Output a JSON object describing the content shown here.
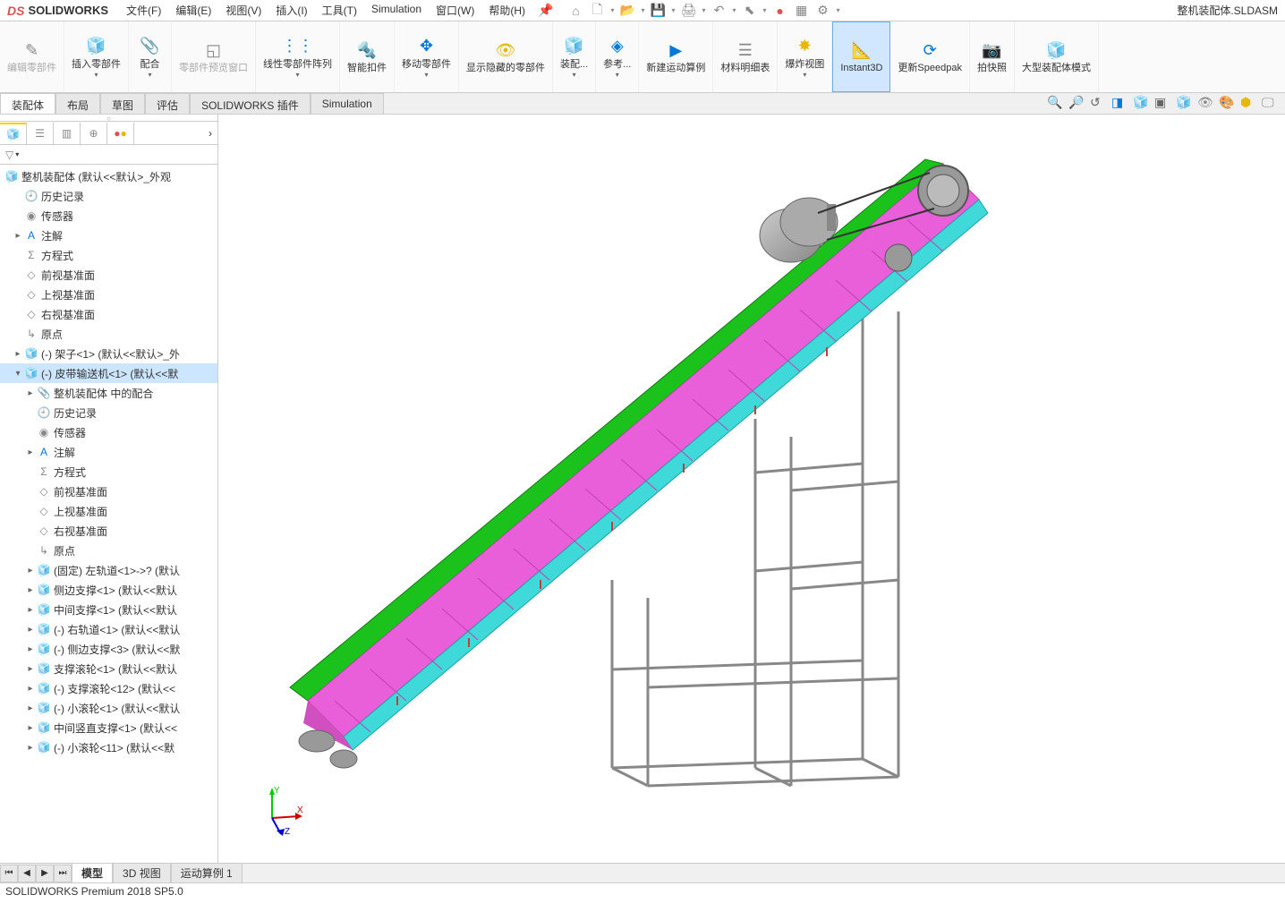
{
  "app": {
    "logo_text": "DS",
    "name": "SOLIDWORKS",
    "doc_title": "整机装配体.SLDASM"
  },
  "menus": [
    {
      "label": "文件(F)"
    },
    {
      "label": "编辑(E)"
    },
    {
      "label": "视图(V)"
    },
    {
      "label": "插入(I)"
    },
    {
      "label": "工具(T)"
    },
    {
      "label": "Simulation"
    },
    {
      "label": "窗口(W)"
    },
    {
      "label": "帮助(H)"
    }
  ],
  "ribbon": [
    {
      "label": "编辑零部件",
      "disabled": true
    },
    {
      "label": "插入零部件",
      "arrow": true
    },
    {
      "label": "配合",
      "arrow": true
    },
    {
      "label": "零部件预览窗口",
      "disabled": true
    },
    {
      "label": "线性零部件阵列",
      "arrow": true
    },
    {
      "label": "智能扣件"
    },
    {
      "label": "移动零部件",
      "arrow": true
    },
    {
      "label": "显示隐藏的零部件"
    },
    {
      "label": "装配...",
      "arrow": true
    },
    {
      "label": "参考...",
      "arrow": true
    },
    {
      "label": "新建运动算例"
    },
    {
      "label": "材料明细表"
    },
    {
      "label": "爆炸视图",
      "arrow": true
    },
    {
      "label": "Instant3D",
      "active": true
    },
    {
      "label": "更新Speedpak"
    },
    {
      "label": "拍快照"
    },
    {
      "label": "大型装配体模式"
    }
  ],
  "tabs": [
    {
      "label": "装配体",
      "active": true
    },
    {
      "label": "布局"
    },
    {
      "label": "草图"
    },
    {
      "label": "评估"
    },
    {
      "label": "SOLIDWORKS 插件"
    },
    {
      "label": "Simulation"
    }
  ],
  "tree_root": "整机装配体  (默认<<默认>_外观",
  "tree": [
    {
      "label": "历史记录",
      "icon": "history",
      "indent": 1
    },
    {
      "label": "传感器",
      "icon": "sensor",
      "indent": 1
    },
    {
      "label": "注解",
      "icon": "annot",
      "indent": 1,
      "expand": "▸"
    },
    {
      "label": "方程式",
      "icon": "eq",
      "indent": 1
    },
    {
      "label": "前视基准面",
      "icon": "plane",
      "indent": 1
    },
    {
      "label": "上视基准面",
      "icon": "plane",
      "indent": 1
    },
    {
      "label": "右视基准面",
      "icon": "plane",
      "indent": 1
    },
    {
      "label": "原点",
      "icon": "origin",
      "indent": 1
    },
    {
      "label": "(-) 架子<1> (默认<<默认>_外",
      "icon": "asm",
      "indent": 1,
      "expand": "▸"
    },
    {
      "label": "(-) 皮带输送机<1> (默认<<默",
      "icon": "asm",
      "indent": 1,
      "expand": "▾",
      "selected": true
    },
    {
      "label": "整机装配体 中的配合",
      "icon": "mate",
      "indent": 2,
      "expand": "▸"
    },
    {
      "label": "历史记录",
      "icon": "history",
      "indent": 2
    },
    {
      "label": "传感器",
      "icon": "sensor",
      "indent": 2
    },
    {
      "label": "注解",
      "icon": "annot",
      "indent": 2,
      "expand": "▸"
    },
    {
      "label": "方程式",
      "icon": "eq",
      "indent": 2
    },
    {
      "label": "前视基准面",
      "icon": "plane",
      "indent": 2
    },
    {
      "label": "上视基准面",
      "icon": "plane",
      "indent": 2
    },
    {
      "label": "右视基准面",
      "icon": "plane",
      "indent": 2
    },
    {
      "label": "原点",
      "icon": "origin",
      "indent": 2
    },
    {
      "label": "(固定) 左轨道<1>->? (默认",
      "icon": "part",
      "indent": 2,
      "expand": "▸"
    },
    {
      "label": "侧边支撑<1> (默认<<默认",
      "icon": "part",
      "indent": 2,
      "expand": "▸"
    },
    {
      "label": "中间支撑<1> (默认<<默认",
      "icon": "part",
      "indent": 2,
      "expand": "▸"
    },
    {
      "label": "(-) 右轨道<1> (默认<<默认",
      "icon": "part",
      "indent": 2,
      "expand": "▸"
    },
    {
      "label": "(-) 侧边支撑<3> (默认<<默",
      "icon": "part",
      "indent": 2,
      "expand": "▸"
    },
    {
      "label": "支撑滚轮<1> (默认<<默认",
      "icon": "part",
      "indent": 2,
      "expand": "▸"
    },
    {
      "label": "(-) 支撑滚轮<12> (默认<<",
      "icon": "part",
      "indent": 2,
      "expand": "▸"
    },
    {
      "label": "(-) 小滚轮<1> (默认<<默认",
      "icon": "part",
      "indent": 2,
      "expand": "▸"
    },
    {
      "label": "中间竖直支撑<1> (默认<<",
      "icon": "part",
      "indent": 2,
      "expand": "▸"
    },
    {
      "label": "(-) 小滚轮<11> (默认<<默",
      "icon": "part",
      "indent": 2,
      "expand": "▸"
    }
  ],
  "bottom_tabs": [
    {
      "label": "模型",
      "active": true
    },
    {
      "label": "3D 视图"
    },
    {
      "label": "运动算例 1"
    }
  ],
  "status": "SOLIDWORKS Premium 2018 SP5.0",
  "triad": {
    "x": "X",
    "y": "Y",
    "z": "Z"
  }
}
